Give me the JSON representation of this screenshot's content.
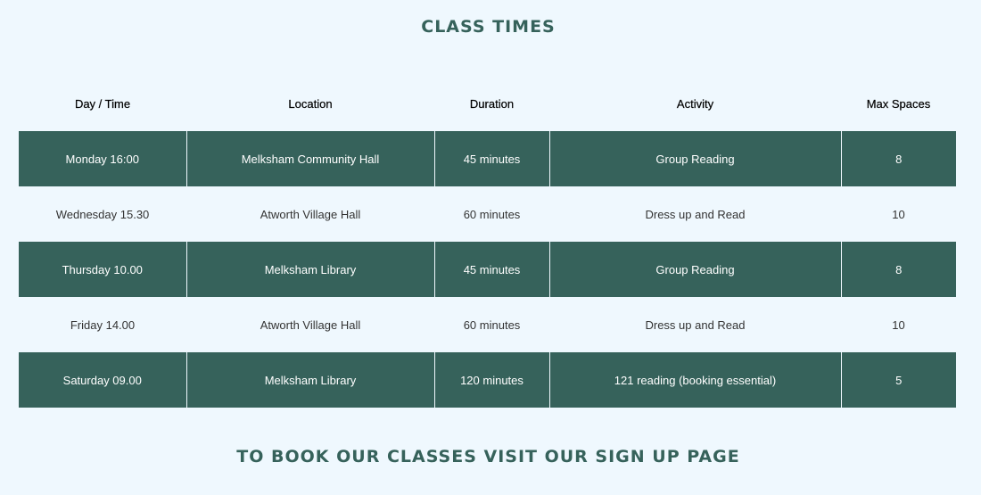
{
  "title": "CLASS TIMES",
  "table": {
    "headers": [
      "Day / Time",
      "Location",
      "Duration",
      "Activity",
      "Max Spaces"
    ],
    "rows": [
      [
        "Monday 16:00",
        "Melksham Community Hall",
        "45 minutes",
        "Group Reading",
        "8"
      ],
      [
        "Wednesday 15.30",
        "Atworth Village Hall",
        "60 minutes",
        "Dress up and Read",
        "10"
      ],
      [
        "Thursday 10.00",
        "Melksham Library",
        "45 minutes",
        "Group Reading",
        "8"
      ],
      [
        "Friday 14.00",
        "Atworth Village Hall",
        "60 minutes",
        "Dress up and Read",
        "10"
      ],
      [
        "Saturday 09.00",
        "Melksham Library",
        "120 minutes",
        "121 reading (booking essential)",
        "5"
      ]
    ]
  },
  "footer": "TO BOOK OUR CLASSES VISIT OUR SIGN UP PAGE",
  "colors": {
    "background": "#eff8fe",
    "accent": "#36625b"
  }
}
